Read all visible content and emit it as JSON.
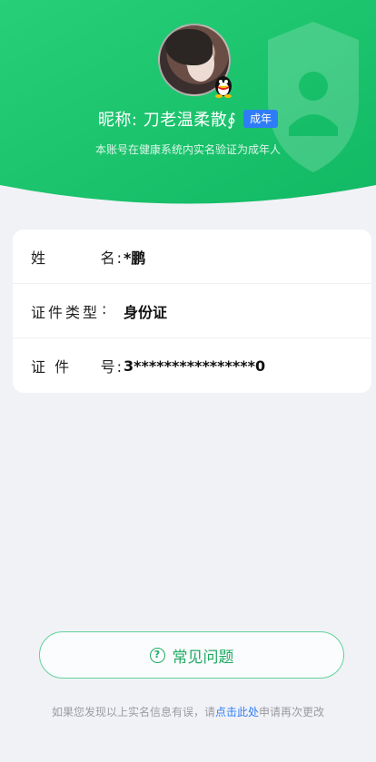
{
  "header": {
    "nickname_label": "昵称:",
    "nickname": "刀老温柔散∮",
    "age_badge": "成年",
    "subtitle": "本账号在健康系统内实名验证为成年人"
  },
  "info": {
    "rows": [
      {
        "label_a": "姓",
        "label_b": "名",
        "colon": ":",
        "value": "*鹏"
      },
      {
        "label_a": "证件类型",
        "label_b": "",
        "colon": ":",
        "value": "身份证"
      },
      {
        "label_a": "证  件",
        "label_b": "号",
        "colon": ":",
        "value": "3****************0"
      }
    ]
  },
  "faq_button": {
    "icon": "?",
    "label": "常见问题"
  },
  "footer": {
    "text_before": "如果您发现以上实名信息有误，请",
    "link": "点击此处",
    "text_after": "申请再次更改"
  },
  "colors": {
    "hero_green": "#1ec870",
    "accent_green": "#1faa63",
    "badge_blue": "#2f7df6"
  }
}
